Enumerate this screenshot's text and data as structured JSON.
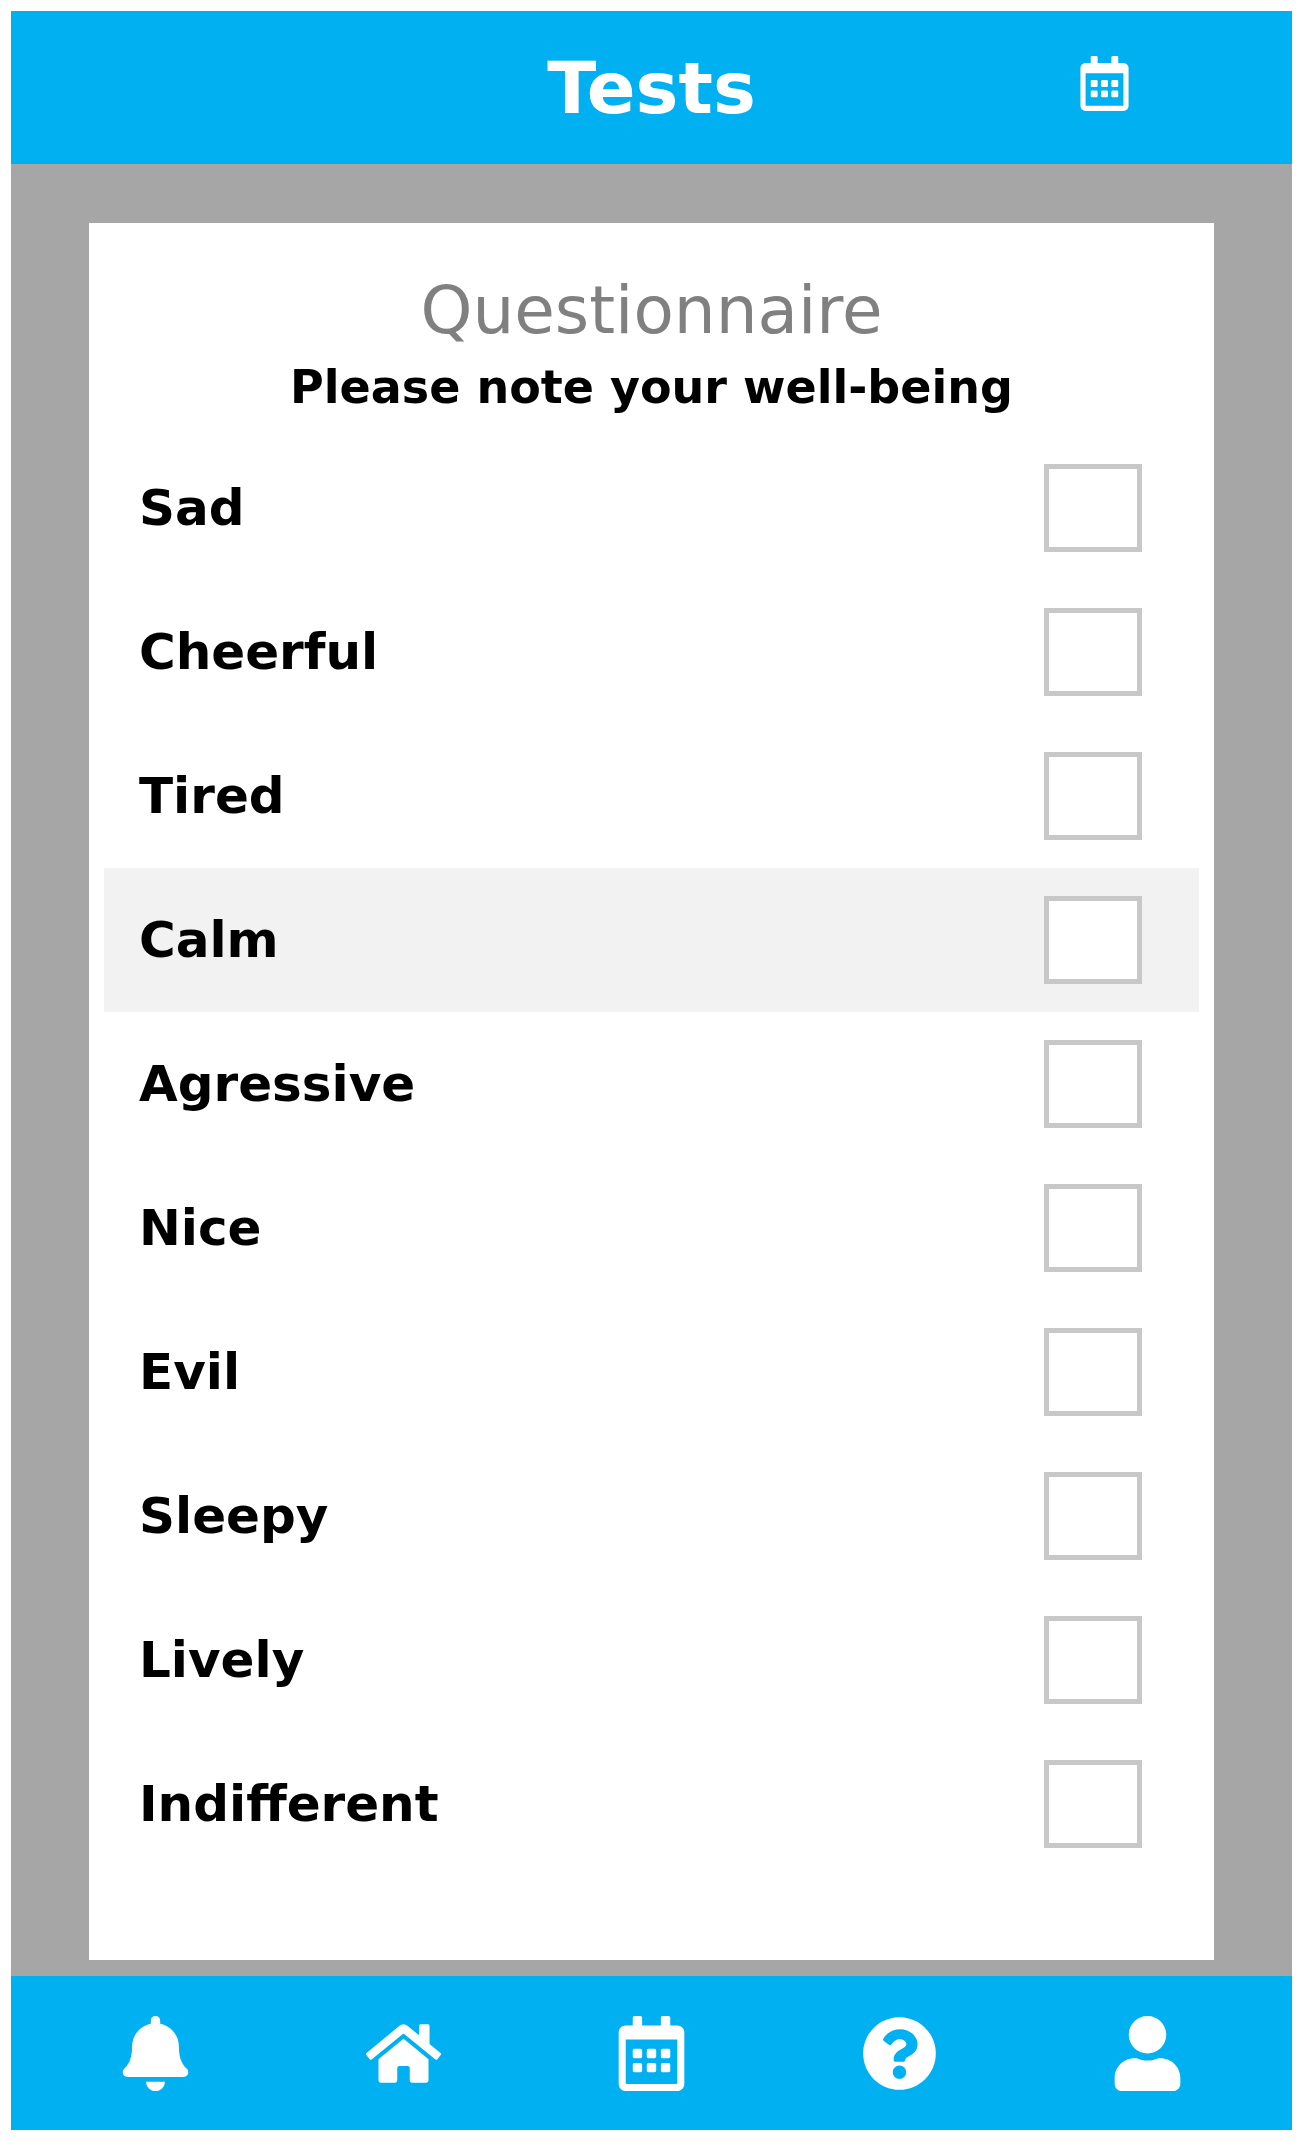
{
  "header": {
    "title": "Tests"
  },
  "card": {
    "title": "Questionnaire",
    "subtitle": "Please note your well-being"
  },
  "items": [
    {
      "label": "Sad",
      "checked": false,
      "selected": false
    },
    {
      "label": "Cheerful",
      "checked": false,
      "selected": false
    },
    {
      "label": "Tired",
      "checked": false,
      "selected": false
    },
    {
      "label": "Calm",
      "checked": false,
      "selected": true
    },
    {
      "label": "Agressive",
      "checked": false,
      "selected": false
    },
    {
      "label": "Nice",
      "checked": false,
      "selected": false
    },
    {
      "label": "Evil",
      "checked": false,
      "selected": false
    },
    {
      "label": "Sleepy",
      "checked": false,
      "selected": false
    },
    {
      "label": "Lively",
      "checked": false,
      "selected": false
    },
    {
      "label": "Indifferent",
      "checked": false,
      "selected": false
    }
  ],
  "nav": [
    {
      "kind": "bell"
    },
    {
      "kind": "home"
    },
    {
      "kind": "calendar"
    },
    {
      "kind": "help"
    },
    {
      "kind": "user"
    }
  ]
}
